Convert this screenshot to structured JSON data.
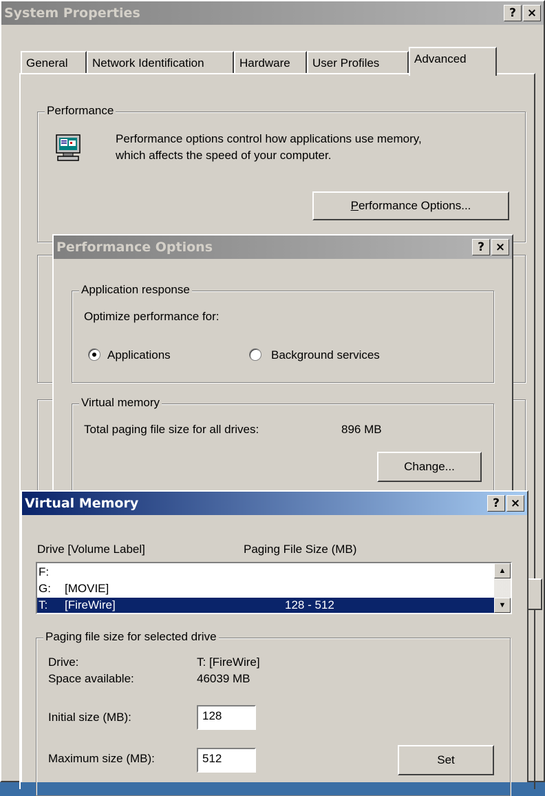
{
  "system_properties": {
    "title": "System Properties",
    "tabs": [
      "General",
      "Network Identification",
      "Hardware",
      "User Profiles",
      "Advanced"
    ],
    "performance": {
      "group_label": "Performance",
      "description_line1": "Performance options control how applications use memory,",
      "description_line2": "which affects the speed of your computer.",
      "button_underlined": "P",
      "button_rest": "erformance Options..."
    }
  },
  "performance_options": {
    "title": "Performance Options",
    "app_response": {
      "group_label": "Application response",
      "optimize_label": "Optimize performance for:",
      "option_applications": "Applications",
      "option_background": "Background services"
    },
    "virtual_memory": {
      "group_label": "Virtual memory",
      "total_label": "Total paging file size for all drives:",
      "total_value": "896 MB",
      "change_button": "Change..."
    }
  },
  "virtual_memory": {
    "title": "Virtual Memory",
    "col_drive": "Drive  [Volume Label]",
    "col_size": "Paging File Size (MB)",
    "drives": [
      {
        "drive": "F:",
        "label": "",
        "size": ""
      },
      {
        "drive": "G:",
        "label": "[MOVIE]",
        "size": ""
      },
      {
        "drive": "T:",
        "label": "[FireWire]",
        "size": "128 - 512"
      }
    ],
    "selected": {
      "group_label": "Paging file size for selected drive",
      "drive_label": "Drive:",
      "drive_value": "T:  [FireWire]",
      "space_label": "Space available:",
      "space_value": "46039 MB",
      "initial_label": "Initial size (MB):",
      "initial_value": "128",
      "max_label": "Maximum size (MB):",
      "max_value": "512",
      "set_button": "Set"
    }
  },
  "titlebar_buttons": {
    "help": "?",
    "close": "×"
  }
}
